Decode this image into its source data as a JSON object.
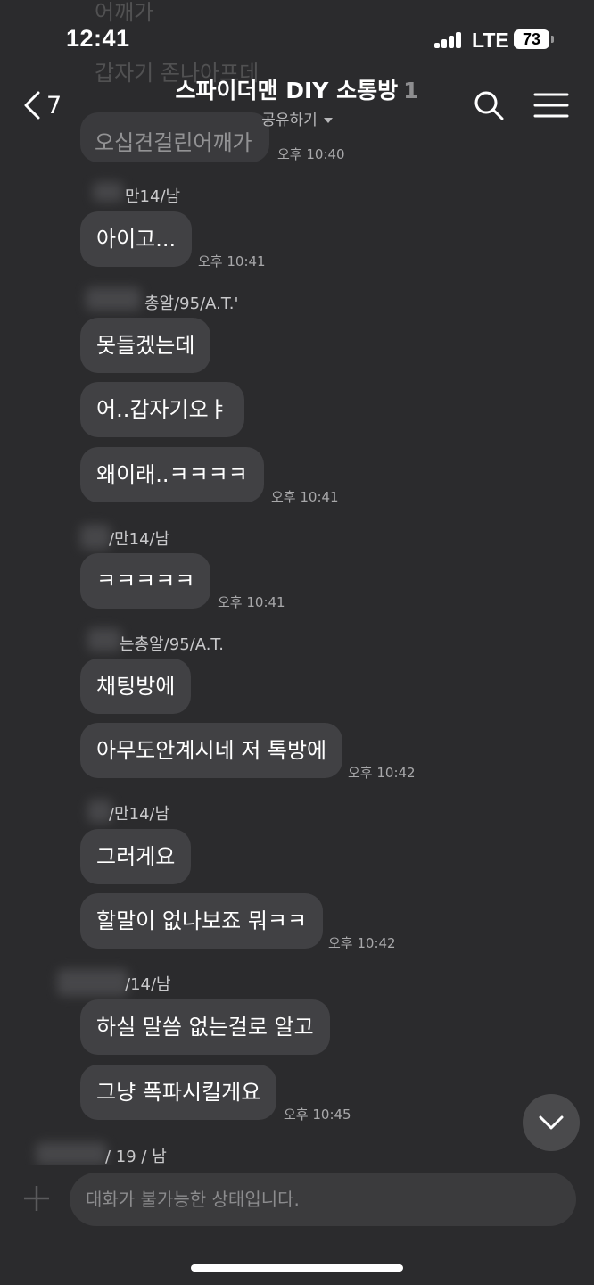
{
  "status": {
    "time": "12:41",
    "network": "LTE",
    "battery": "73"
  },
  "header": {
    "back_count": "7",
    "title": "스파이더맨 DIY 소통방",
    "unread": "1",
    "share": "공유하기"
  },
  "faded_texts": [
    "어깨가",
    "갑자기 존나아프데",
    "오십견걸린어깨가"
  ],
  "messages": [
    {
      "text": "아이고...",
      "time": "오후 10:41"
    },
    {
      "text": "못들겠는데"
    },
    {
      "text": "어..갑자기오ㅑ"
    },
    {
      "text": "왜이래..ㅋㅋㅋㅋ",
      "time": "오후 10:41"
    },
    {
      "text": "ㅋㅋㅋㅋㅋ",
      "time": "오후 10:41"
    },
    {
      "text": "채팅방에"
    },
    {
      "text": "아무도안계시네 저 톡방에",
      "time": "오후 10:42"
    },
    {
      "text": "그러게요"
    },
    {
      "text": "할말이 없나보죠 뭐ㅋㅋ",
      "time": "오후 10:42"
    },
    {
      "text": "하실 말씀 없는걸로 알고"
    },
    {
      "text": "그냥 폭파시킬게요",
      "time": "오후 10:45"
    }
  ],
  "senders": [
    "만14/남",
    "총알/95/A.T.'",
    "/만14/남",
    "는총알/95/A.T.",
    "/만14/남",
    "/14/남",
    "/ 19 / 남"
  ],
  "first_time": "오후 10:40",
  "input": {
    "placeholder": "대화가 불가능한 상태입니다."
  }
}
